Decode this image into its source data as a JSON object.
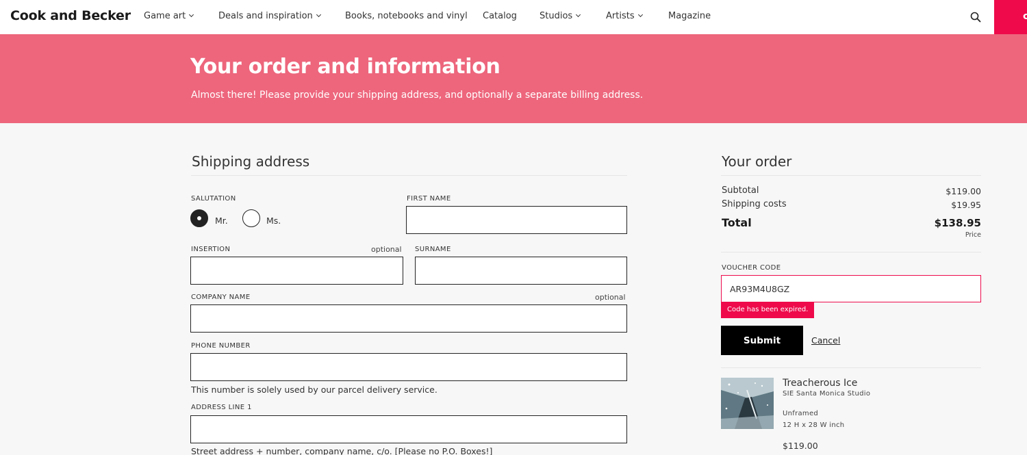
{
  "nav": {
    "logo": "Cook and Becker",
    "items": [
      {
        "label": "Game art"
      },
      {
        "label": "Deals and inspiration"
      },
      {
        "label": "Books, notebooks and vinyl"
      },
      {
        "label": "Catalog"
      },
      {
        "label": "Studios"
      },
      {
        "label": "Artists"
      },
      {
        "label": "Magazine"
      }
    ],
    "cart_label": "c"
  },
  "banner": {
    "title": "Your order and information",
    "subtitle": "Almost there! Please provide your shipping address, and optionally a separate billing address."
  },
  "shipping": {
    "title": "Shipping address",
    "salutation_label": "SALUTATION",
    "salutation_options": [
      {
        "label": "Mr.",
        "selected": true
      },
      {
        "label": "Ms.",
        "selected": false
      }
    ],
    "first_name_label": "FIRST NAME",
    "insertion_label": "INSERTION",
    "optional_text": "optional",
    "surname_label": "SURNAME",
    "company_label": "COMPANY NAME",
    "phone_label": "PHONE NUMBER",
    "phone_help": "This number is solely used by our parcel delivery service.",
    "address1_label": "ADDRESS LINE 1",
    "address1_help": "Street address + number, company name, c/o. [Please no P.O. Boxes!]"
  },
  "order": {
    "title": "Your order",
    "subtotal_label": "Subtotal",
    "subtotal_value": "$119.00",
    "shipping_label": "Shipping costs",
    "shipping_value": "$19.95",
    "total_label": "Total",
    "total_value": "$138.95",
    "price_note": "Price",
    "voucher_label": "VOUCHER CODE",
    "voucher_value": "AR93M4U8GZ",
    "voucher_error": "Code has been expired.",
    "submit_label": "Submit",
    "cancel_label": "Cancel",
    "product": {
      "name": "Treacherous Ice",
      "studio": "SIE Santa Monica Studio",
      "frame": "Unframed",
      "size": "12 H x 28 W inch",
      "price": "$119.00"
    }
  },
  "colors": {
    "accent": "#ee0a4b",
    "banner": "#ed667c"
  }
}
